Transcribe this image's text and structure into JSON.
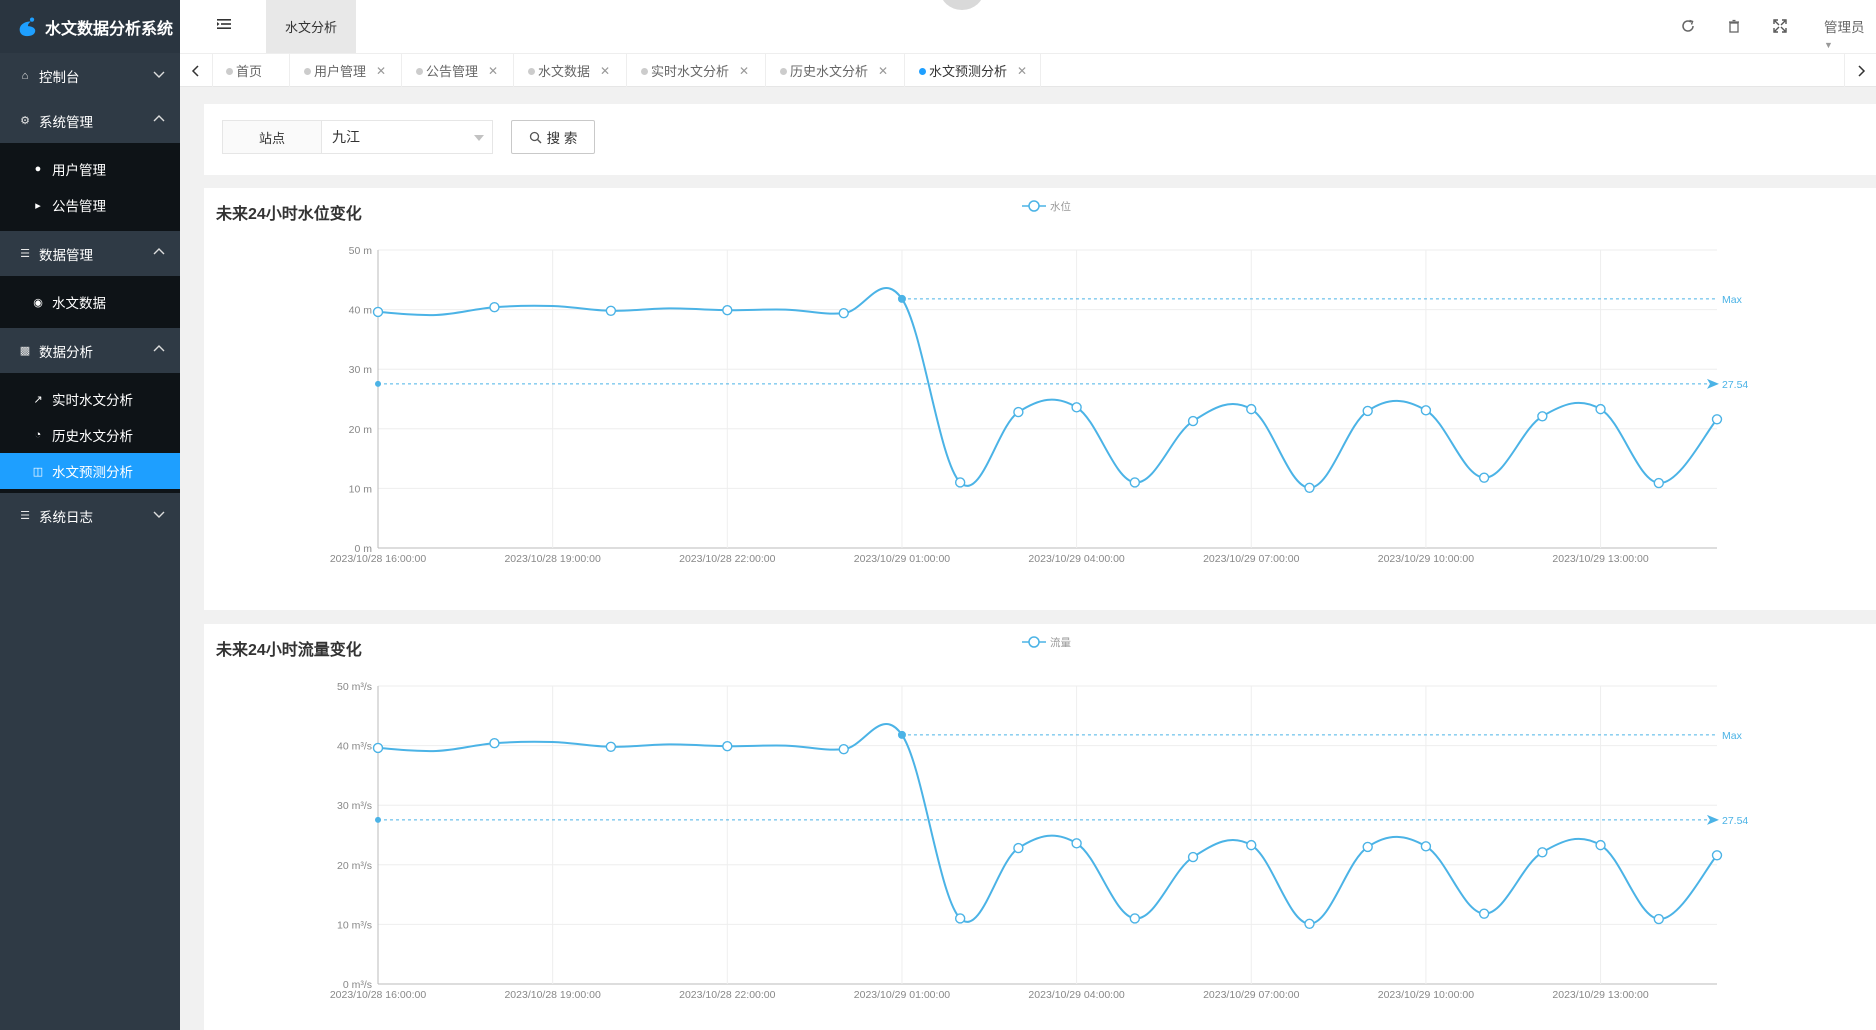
{
  "app": {
    "title": "水文数据分析系统"
  },
  "header": {
    "active_tab": "水文分析",
    "user": "管理员"
  },
  "sidebar": {
    "items": [
      {
        "label": "控制台",
        "icon": "home-icon",
        "expanded": false
      },
      {
        "label": "系统管理",
        "icon": "gears-icon",
        "expanded": true,
        "children": [
          {
            "label": "用户管理",
            "icon": "users-icon"
          },
          {
            "label": "公告管理",
            "icon": "speaker-icon"
          }
        ]
      },
      {
        "label": "数据管理",
        "icon": "list-icon",
        "expanded": true,
        "children": [
          {
            "label": "水文数据",
            "icon": "globe-icon"
          }
        ]
      },
      {
        "label": "数据分析",
        "icon": "bar-chart-icon",
        "expanded": true,
        "children": [
          {
            "label": "实时水文分析",
            "icon": "line-chart-icon"
          },
          {
            "label": "历史水文分析",
            "icon": "pie-chart-icon"
          },
          {
            "label": "水文预测分析",
            "icon": "database-icon",
            "active": true
          }
        ]
      },
      {
        "label": "系统日志",
        "icon": "list-icon",
        "expanded": false
      }
    ]
  },
  "tabs": [
    {
      "label": "首页",
      "closable": false
    },
    {
      "label": "用户管理",
      "closable": true
    },
    {
      "label": "公告管理",
      "closable": true
    },
    {
      "label": "水文数据",
      "closable": true
    },
    {
      "label": "实时水文分析",
      "closable": true
    },
    {
      "label": "历史水文分析",
      "closable": true
    },
    {
      "label": "水文预测分析",
      "closable": true,
      "active": true
    }
  ],
  "search": {
    "station_label": "站点",
    "station_value": "九江",
    "button_label": "搜 索"
  },
  "colors": {
    "accent": "#1e9fff",
    "series": "#4bb3e6",
    "sidebar": "#2f3a45"
  },
  "chart_data": [
    {
      "type": "line",
      "title": "未来24小时水位变化",
      "series": [
        {
          "name": "水位",
          "values": [
            39.6,
            39.1,
            40.4,
            40.6,
            39.8,
            40.2,
            39.9,
            40.0,
            39.4,
            41.8,
            11.0,
            22.8,
            23.6,
            11.0,
            21.3,
            23.3,
            10.1,
            23.0,
            23.1,
            11.8,
            22.1,
            23.3,
            10.9,
            21.6
          ]
        }
      ],
      "x": [
        "2023/10/28 16:00:00",
        "2023/10/28 17:00:00",
        "2023/10/28 18:00:00",
        "2023/10/28 19:00:00",
        "2023/10/28 20:00:00",
        "2023/10/28 21:00:00",
        "2023/10/28 22:00:00",
        "2023/10/28 23:00:00",
        "2023/10/29 00:00:00",
        "2023/10/29 01:00:00",
        "2023/10/29 02:00:00",
        "2023/10/29 03:00:00",
        "2023/10/29 04:00:00",
        "2023/10/29 05:00:00",
        "2023/10/29 06:00:00",
        "2023/10/29 07:00:00",
        "2023/10/29 08:00:00",
        "2023/10/29 09:00:00",
        "2023/10/29 10:00:00",
        "2023/10/29 11:00:00",
        "2023/10/29 12:00:00",
        "2023/10/29 13:00:00",
        "2023/10/29 14:00:00",
        "2023/10/29 15:00:00"
      ],
      "x_tick_labels": [
        "2023/10/28 16:00:00",
        "2023/10/28 19:00:00",
        "2023/10/28 22:00:00",
        "2023/10/29 01:00:00",
        "2023/10/29 04:00:00",
        "2023/10/29 07:00:00",
        "2023/10/29 10:00:00",
        "2023/10/29 13:00:00"
      ],
      "y_ticks": [
        "0 m",
        "10 m",
        "20 m",
        "30 m",
        "40 m",
        "50 m"
      ],
      "ylim": [
        0,
        50
      ],
      "mark_lines": [
        {
          "label": "Max",
          "value": 41.8
        },
        {
          "label": "27.54",
          "value": 27.54
        }
      ],
      "legend": "top-center",
      "grid": true
    },
    {
      "type": "line",
      "title": "未来24小时流量变化",
      "series": [
        {
          "name": "流量",
          "values": [
            39.6,
            39.1,
            40.4,
            40.6,
            39.8,
            40.2,
            39.9,
            40.0,
            39.4,
            41.8,
            11.0,
            22.8,
            23.6,
            11.0,
            21.3,
            23.3,
            10.1,
            23.0,
            23.1,
            11.8,
            22.1,
            23.3,
            10.9,
            21.6
          ]
        }
      ],
      "x": [
        "2023/10/28 16:00:00",
        "2023/10/28 17:00:00",
        "2023/10/28 18:00:00",
        "2023/10/28 19:00:00",
        "2023/10/28 20:00:00",
        "2023/10/28 21:00:00",
        "2023/10/28 22:00:00",
        "2023/10/28 23:00:00",
        "2023/10/29 00:00:00",
        "2023/10/29 01:00:00",
        "2023/10/29 02:00:00",
        "2023/10/29 03:00:00",
        "2023/10/29 04:00:00",
        "2023/10/29 05:00:00",
        "2023/10/29 06:00:00",
        "2023/10/29 07:00:00",
        "2023/10/29 08:00:00",
        "2023/10/29 09:00:00",
        "2023/10/29 10:00:00",
        "2023/10/29 11:00:00",
        "2023/10/29 12:00:00",
        "2023/10/29 13:00:00",
        "2023/10/29 14:00:00",
        "2023/10/29 15:00:00"
      ],
      "x_tick_labels": [
        "2023/10/28 16:00:00",
        "2023/10/28 19:00:00",
        "2023/10/28 22:00:00",
        "2023/10/29 01:00:00",
        "2023/10/29 04:00:00",
        "2023/10/29 07:00:00",
        "2023/10/29 10:00:00",
        "2023/10/29 13:00:00"
      ],
      "y_ticks": [
        "0 m³/s",
        "10 m³/s",
        "20 m³/s",
        "30 m³/s",
        "40 m³/s",
        "50 m³/s"
      ],
      "ylim": [
        0,
        50
      ],
      "mark_lines": [
        {
          "label": "Max",
          "value": 41.8
        },
        {
          "label": "27.54",
          "value": 27.54
        }
      ],
      "legend": "top-center",
      "grid": true
    }
  ]
}
